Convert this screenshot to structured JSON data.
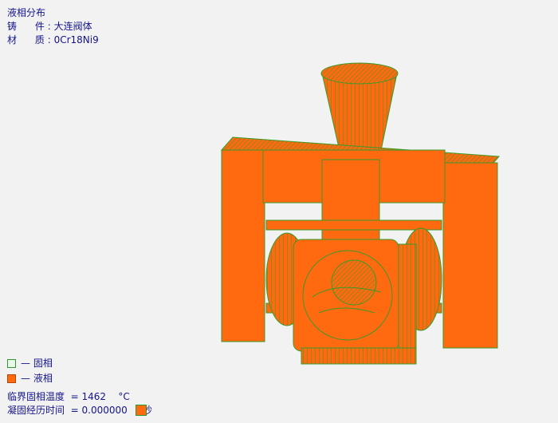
{
  "title": "液相分布",
  "casting": {
    "label": "铸      件",
    "sep": " : ",
    "value": "大连阀体"
  },
  "material": {
    "label": "材      质",
    "sep": " : ",
    "value": "0Cr18Ni9"
  },
  "legend": {
    "solid": {
      "label": "— 固相",
      "color": "#eaf8ea"
    },
    "liquid": {
      "label": "— 液相",
      "color": "#ff6a10"
    }
  },
  "status": {
    "temp_label": "临界固相温度",
    "temp_eq": "  = ",
    "temp_value": "1462",
    "temp_unit": "°C",
    "time_label": "凝固经历时间",
    "time_eq": "  = ",
    "time_value": "0.000000",
    "time_unit": "秒"
  },
  "colors": {
    "liquid": "#ff6a10",
    "edge": "#3a9a2a",
    "text": "#14148c",
    "background": "#f2f2f2"
  }
}
